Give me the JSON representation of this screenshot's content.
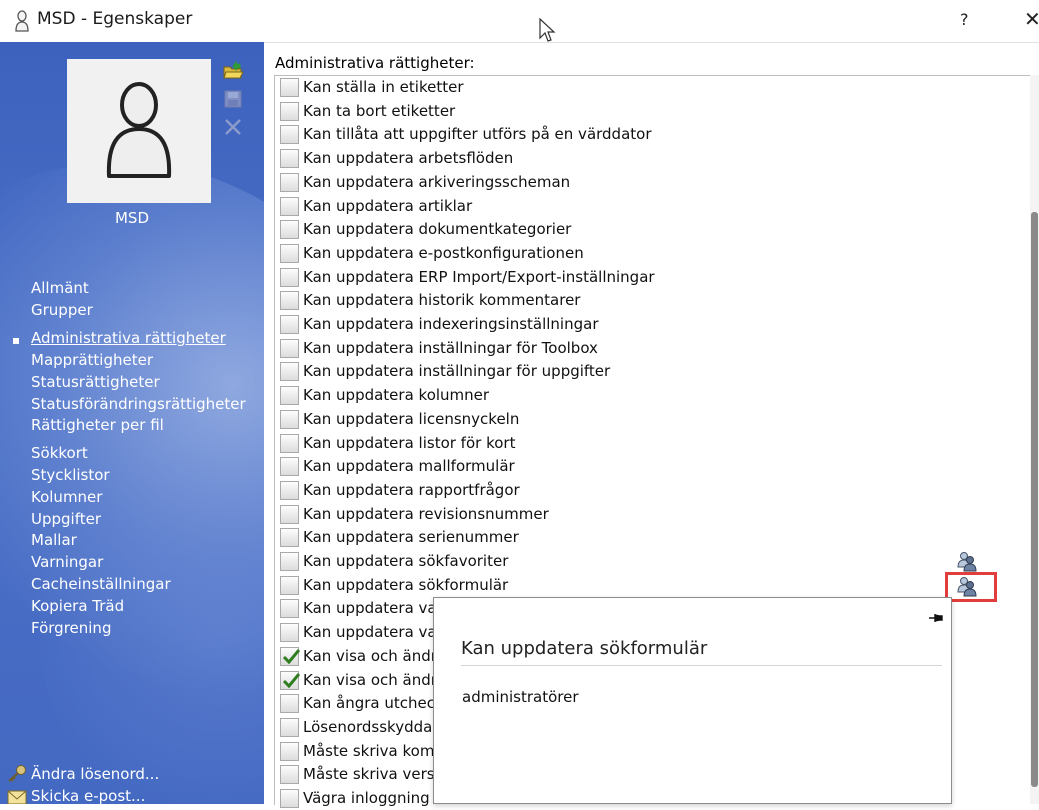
{
  "window": {
    "title": "MSD - Egenskaper",
    "help_label": "?",
    "close_label": "✕"
  },
  "user": {
    "name": "MSD"
  },
  "nav": {
    "groups": [
      [
        "Allmänt",
        "Grupper"
      ],
      [
        "Administrativa rättigheter",
        "Mapprättigheter",
        "Statusrättigheter",
        "Statusförändringsrättigheter",
        "Rättigheter per fil"
      ],
      [
        "Sökkort",
        "Stycklistor",
        "Kolumner",
        "Uppgifter",
        "Mallar",
        "Varningar",
        "Cacheinställningar",
        "Kopiera Träd",
        "Förgrening"
      ]
    ],
    "active": "Administrativa rättigheter"
  },
  "footer": {
    "change_password": "Ändra lösenord...",
    "send_email": "Skicka e-post..."
  },
  "main": {
    "header": "Administrativa rättigheter:",
    "permissions": [
      {
        "label": "Kan ställa in etiketter",
        "checked": false
      },
      {
        "label": "Kan ta bort etiketter",
        "checked": false
      },
      {
        "label": "Kan tillåta att uppgifter utförs på en värddator",
        "checked": false
      },
      {
        "label": "Kan uppdatera arbetsflöden",
        "checked": false
      },
      {
        "label": "Kan uppdatera arkiveringsscheman",
        "checked": false
      },
      {
        "label": "Kan uppdatera artiklar",
        "checked": false
      },
      {
        "label": "Kan uppdatera dokumentkategorier",
        "checked": false
      },
      {
        "label": "Kan uppdatera e-postkonfigurationen",
        "checked": false
      },
      {
        "label": "Kan uppdatera ERP Import/Export-inställningar",
        "checked": false
      },
      {
        "label": "Kan uppdatera historik kommentarer",
        "checked": false
      },
      {
        "label": "Kan uppdatera indexeringsinställningar",
        "checked": false
      },
      {
        "label": "Kan uppdatera inställningar för Toolbox",
        "checked": false
      },
      {
        "label": "Kan uppdatera inställningar för uppgifter",
        "checked": false
      },
      {
        "label": "Kan uppdatera kolumner",
        "checked": false
      },
      {
        "label": "Kan uppdatera licensnyckeln",
        "checked": false
      },
      {
        "label": "Kan uppdatera listor för kort",
        "checked": false
      },
      {
        "label": "Kan uppdatera mallformulär",
        "checked": false
      },
      {
        "label": "Kan uppdatera rapportfrågor",
        "checked": false
      },
      {
        "label": "Kan uppdatera revisionsnummer",
        "checked": false
      },
      {
        "label": "Kan uppdatera serienummer",
        "checked": false
      },
      {
        "label": "Kan uppdatera sökfavoriter",
        "checked": false,
        "group_icon": true
      },
      {
        "label": "Kan uppdatera sökformulär",
        "checked": false,
        "group_icon": true,
        "highlighted": true
      },
      {
        "label": "Kan uppdatera valv",
        "checked": false
      },
      {
        "label": "Kan uppdatera vari",
        "checked": false
      },
      {
        "label": "Kan visa och ändra",
        "checked": true
      },
      {
        "label": "Kan visa och ändra",
        "checked": true
      },
      {
        "label": "Kan ångra utchecka",
        "checked": false
      },
      {
        "label": "Lösenordsskyddad",
        "checked": false
      },
      {
        "label": "Måste skriva komm",
        "checked": false
      },
      {
        "label": "Måste skriva versio",
        "checked": false
      },
      {
        "label": "Vägra inloggning",
        "checked": false
      }
    ]
  },
  "popup": {
    "title": "Kan uppdatera sökformulär",
    "body": "administratörer"
  },
  "colors": {
    "sidebar": "#4469c2",
    "highlight": "#e23d3d",
    "checkmark": "#2e7d1f"
  },
  "icons": {
    "title": "user-icon",
    "sidebar_tools": [
      "open-folder-icon",
      "save-icon",
      "delete-icon"
    ],
    "footer": [
      "key-icon",
      "envelope-icon"
    ],
    "permission_badge": "user-group-icon",
    "popup": "pin-icon"
  }
}
